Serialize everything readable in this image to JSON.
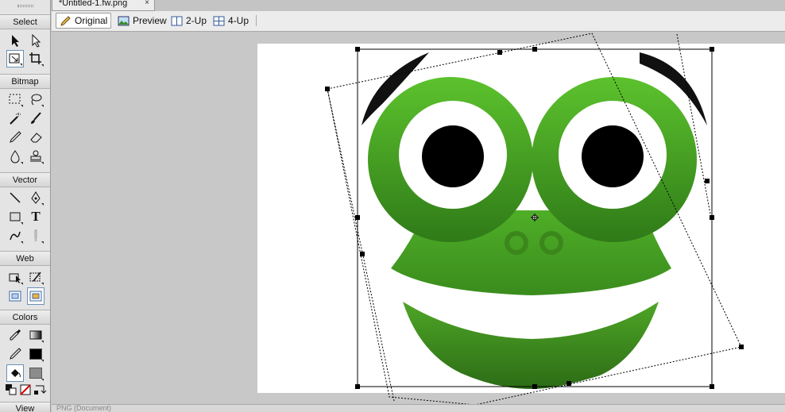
{
  "document": {
    "tab_title": "*Untitled-1.fw.png",
    "close_glyph": "×"
  },
  "tools_panel": {
    "sections": [
      {
        "label": "Select"
      },
      {
        "label": "Bitmap"
      },
      {
        "label": "Vector"
      },
      {
        "label": "Web"
      },
      {
        "label": "Colors"
      },
      {
        "label": "View"
      }
    ],
    "text_tool_glyph": "T",
    "stroke_color": "#000000",
    "fill_color": "#8c8c8c"
  },
  "view_bar": {
    "original": "Original",
    "preview": "Preview",
    "two_up": "2-Up",
    "four_up": "4-Up"
  },
  "status": {
    "text": "PNG (Document)"
  },
  "colors": {
    "frog_green": "#4aa526",
    "frog_dark": "#2c6f17",
    "selection": "#000000"
  }
}
